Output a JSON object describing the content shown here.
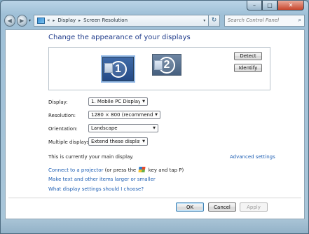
{
  "window": {
    "caption_min": "–",
    "caption_max": "□",
    "caption_close": "✕"
  },
  "nav": {
    "back_glyph": "◀",
    "forward_glyph": "▶",
    "history_glyph": "▾",
    "breadcrumb_prefix": "«",
    "breadcrumb": [
      "Display",
      "Screen Resolution"
    ],
    "breadcrumb_sep": "▸",
    "address_dropdown": "▾",
    "refresh_glyph": "↻",
    "search_placeholder": "Search Control Panel",
    "search_glyph": "⌕"
  },
  "page": {
    "title": "Change the appearance of your displays"
  },
  "monitors": [
    {
      "number": "1",
      "selected": true
    },
    {
      "number": "2",
      "selected": false
    }
  ],
  "buttons": {
    "detect": "Detect",
    "identify": "Identify",
    "ok": "OK",
    "cancel": "Cancel",
    "apply": "Apply"
  },
  "settings": {
    "display": {
      "label": "Display:",
      "value": "1. Mobile PC Display"
    },
    "resolution": {
      "label": "Resolution:",
      "value": "1280 × 800 (recommended)"
    },
    "orientation": {
      "label": "Orientation:",
      "value": "Landscape"
    },
    "multiple": {
      "label": "Multiple displays:",
      "value": "Extend these displays"
    },
    "dropdown_glyph": "▼"
  },
  "status": {
    "main_display": "This is currently your main display.",
    "advanced_link": "Advanced settings"
  },
  "links": {
    "projector": "Connect to a projector",
    "projector_suffix_1": "(or press the",
    "projector_suffix_2": "key and tap P)",
    "text_size": "Make text and other items larger or smaller",
    "which_settings": "What display settings should I choose?"
  },
  "colors": {
    "link": "#1e5fb4",
    "title": "#1e3a8a",
    "monitor_selected": "#244a86",
    "monitor_other": "#46607f"
  }
}
